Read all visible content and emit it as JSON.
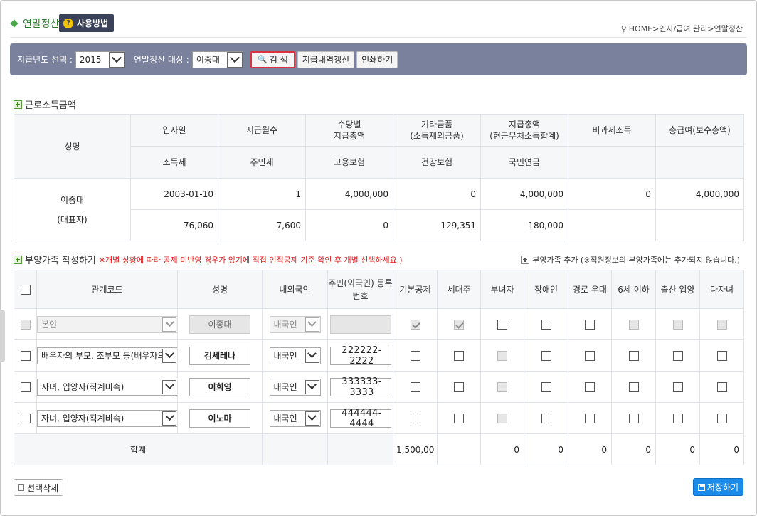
{
  "page": {
    "title": "연말정산",
    "usage_button": "사용방법",
    "breadcrumb": [
      "HOME",
      "인사/급여 관리",
      "연말정산"
    ]
  },
  "toolbar": {
    "year_label": "지급년도 선택 :",
    "year_value": "2015",
    "target_label": "연말정산 대상 :",
    "target_value": "이종대",
    "search_button": "검 색",
    "update_button": "지급내역갱신",
    "print_button": "인쇄하기"
  },
  "income": {
    "section_title": "근로소득금액",
    "headers_row1": [
      "성명",
      "입사일",
      "지급월수",
      "수당별\n지급총액",
      "기타금품\n(소득제외금품)",
      "지급총액\n(현근무처소득합계)",
      "비과세소득",
      "총급여(보수총액)"
    ],
    "headers_row2": [
      "소득세",
      "주민세",
      "고용보험",
      "건강보험",
      "국민연금",
      "",
      ""
    ],
    "name": "이종대",
    "name_note": "(대표자)",
    "row1": [
      "2003-01-10",
      "1",
      "4,000,000",
      "0",
      "4,000,000",
      "0",
      "4,000,000"
    ],
    "row2": [
      "76,060",
      "7,600",
      "0",
      "129,351",
      "180,000",
      "",
      ""
    ]
  },
  "dependents": {
    "section_title": "부양가족 작성하기",
    "warning": "※개별 상황에 따라 공제 미반영 경우가 있기에 직접 인적공제 기준 확인 후 개별 선택하세요.)",
    "add_link": "부양가족 추가 (※직원정보의 부양가족에는 추가되지 않습니다.)",
    "headers": [
      "관계코드",
      "성명",
      "내외국인",
      "주민(외국인) 등록\n번호",
      "기본공제",
      "세대주",
      "부녀자",
      "장애인",
      "경로 우대",
      "6세 이하",
      "출산 입양",
      "다자녀"
    ],
    "rows": [
      {
        "relation": "본인",
        "name": "이종대",
        "nationality": "내국인",
        "rrn": "",
        "disabled": true
      },
      {
        "relation": "배우자의 부모, 조부모 등(배우자의 직",
        "name": "김세레나",
        "nationality": "내국인",
        "rrn": "222222-2222",
        "disabled": false
      },
      {
        "relation": "자녀, 입양자(직계비속)",
        "name": "이희영",
        "nationality": "내국인",
        "rrn": "333333-3333",
        "disabled": false
      },
      {
        "relation": "자녀, 입양자(직계비속)",
        "name": "이노마",
        "nationality": "내국인",
        "rrn": "444444-4444",
        "disabled": false
      }
    ],
    "total_label": "합계",
    "totals": [
      "1,500,00",
      "",
      "0",
      "0",
      "0",
      "0",
      "0",
      "0"
    ]
  },
  "actions": {
    "delete_button": "선택삭제",
    "save_button": "저장하기"
  },
  "colors": {
    "toolbar_bg": "#7a819c",
    "accent_green": "#2d7a2d",
    "save_blue": "#1a8be8",
    "warning_red": "#e01f1f"
  }
}
